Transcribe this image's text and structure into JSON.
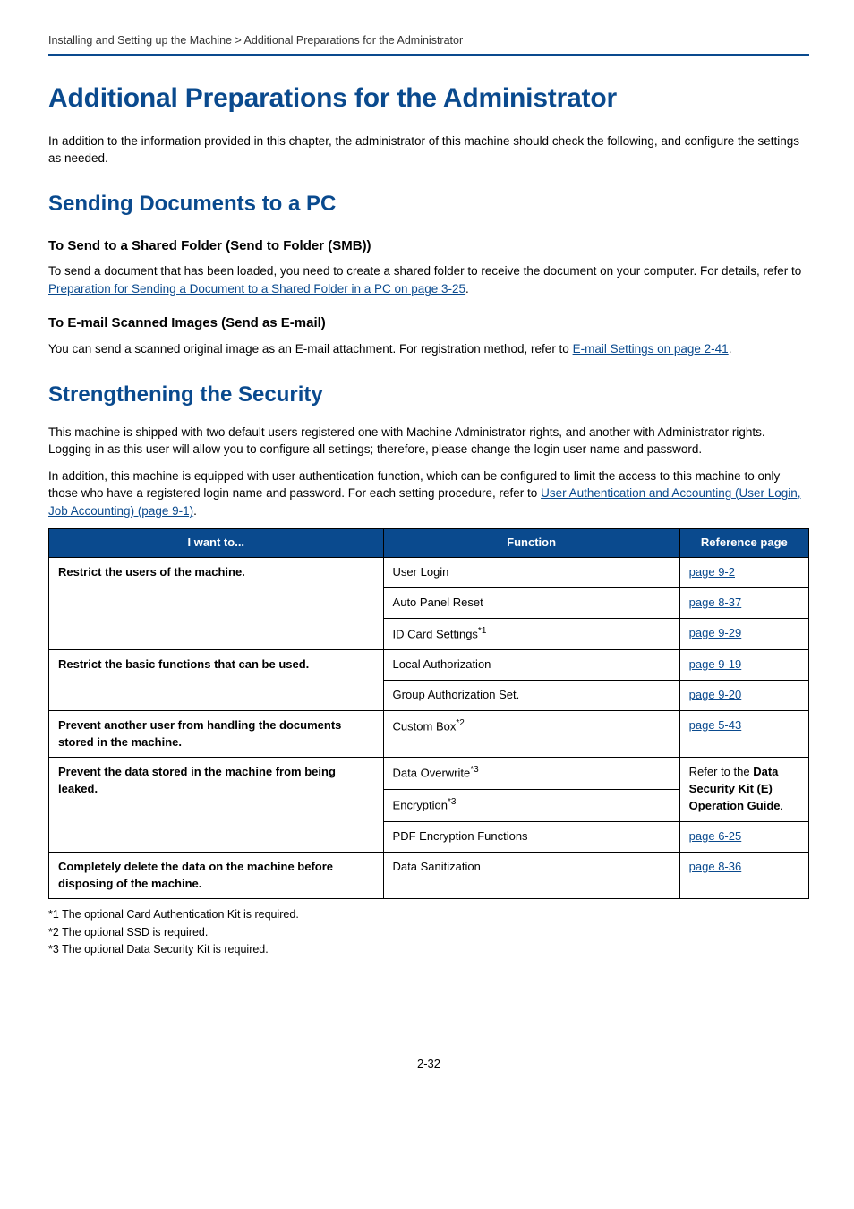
{
  "breadcrumb": "Installing and Setting up the Machine > Additional Preparations for the Administrator",
  "h1": "Additional Preparations for the Administrator",
  "intro": "In addition to the information provided in this chapter, the administrator of this machine should check the following, and configure the settings as needed.",
  "section1": {
    "title": "Sending Documents to a PC",
    "sub1": {
      "heading": "To Send to a Shared Folder (Send to Folder (SMB))",
      "para_pre": "To send a document that has been loaded, you need to create a shared folder to receive the document on your computer. For details, refer to ",
      "link": "Preparation for Sending a Document to a Shared Folder in a PC on page 3-25",
      "para_post": "."
    },
    "sub2": {
      "heading": "To E-mail Scanned Images (Send as E-mail)",
      "para_pre": "You can send a scanned original image as an E-mail attachment. For registration method, refer to ",
      "link": "E-mail Settings on page 2-41",
      "para_post": "."
    }
  },
  "section2": {
    "title": "Strengthening the Security",
    "para1": "This machine is shipped with two default users registered one with Machine Administrator rights, and another with Administrator rights. Logging in as this user will allow you to configure all settings; therefore, please change the login user name and password.",
    "para2_pre": "In addition, this machine is equipped with user authentication function, which can be configured to limit the access to this machine to only those who have a registered login name and password. For each setting procedure, refer to ",
    "para2_link": "User Authentication and Accounting (User Login, Job Accounting) (page 9-1)",
    "para2_post": "."
  },
  "table": {
    "headers": {
      "c1": "I want to...",
      "c2": "Function",
      "c3": "Reference page"
    },
    "r1": {
      "want": "Restrict the users of the machine.",
      "fn1": "User Login",
      "ref1": "page 9-2",
      "fn2": "Auto Panel Reset",
      "ref2": "page 8-37",
      "fn3_pre": "ID Card Settings",
      "fn3_sup": "*1",
      "ref3": "page 9-29"
    },
    "r2": {
      "want": "Restrict the basic functions that can be used.",
      "fn1": "Local Authorization",
      "ref1": "page 9-19",
      "fn2": "Group Authorization Set.",
      "ref2": "page 9-20"
    },
    "r3": {
      "want": "Prevent another user from handling the documents stored in the machine.",
      "fn_pre": "Custom Box",
      "fn_sup": "*2",
      "ref": "page 5-43"
    },
    "r4": {
      "want": "Prevent the data stored in the machine from being leaked.",
      "fn1_pre": "Data Overwrite",
      "fn1_sup": "*3",
      "fn2_pre": "Encryption",
      "fn2_sup": "*3",
      "ref12_pre": "Refer to the ",
      "ref12_bold": "Data Security Kit (E) Operation Guide",
      "ref12_post": ".",
      "fn3": "PDF Encryption Functions",
      "ref3": "page 6-25"
    },
    "r5": {
      "want": "Completely delete the data on the machine before disposing of the machine.",
      "fn": "Data Sanitization",
      "ref": "page 8-36"
    }
  },
  "footnotes": {
    "f1": "*1   The optional Card Authentication Kit is required.",
    "f2": "*2   The optional SSD is required.",
    "f3": "*3   The optional Data Security Kit is required."
  },
  "page_number": "2-32"
}
